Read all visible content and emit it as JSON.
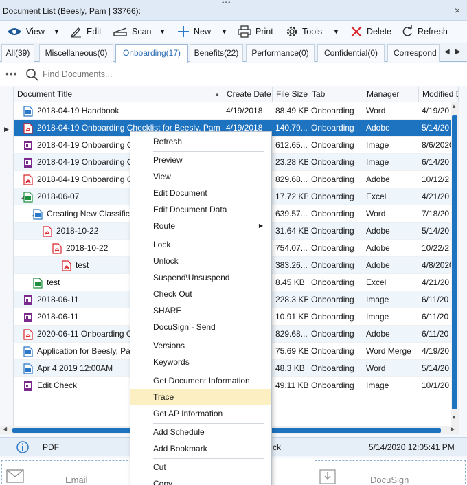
{
  "window": {
    "title": "Document List (Beesly, Pam | 33766):",
    "grip": "•••",
    "close_glyph": "×"
  },
  "toolbar": {
    "view": "View",
    "edit": "Edit",
    "scan": "Scan",
    "new": "New",
    "print": "Print",
    "tools": "Tools",
    "delete": "Delete",
    "refresh": "Refresh",
    "dropdown_glyph": "▼"
  },
  "tabs": {
    "items": [
      "All(39)",
      "Miscellaneous(0)",
      "Onboarding(17)",
      "Benefits(22)",
      "Performance(0)",
      "Confidential(0)",
      "Correspond"
    ],
    "active_index": 2,
    "prev_glyph": "◀",
    "next_glyph": "▶"
  },
  "search": {
    "more_glyph": "•••",
    "placeholder": "Find Documents..."
  },
  "grid": {
    "columns": [
      "Document Title",
      "Create Date",
      "File Size",
      "Tab",
      "Manager",
      "Modified D"
    ],
    "sort_glyph": "▲",
    "current_row_glyph": "▶",
    "expand_glyph": "◢",
    "rows": [
      {
        "title": "2018-04-19 Handbook",
        "date": "4/19/2018",
        "size": "88.49 KB",
        "tab": "Onboarding",
        "manager": "Word",
        "modified": "4/19/20"
      },
      {
        "title": "2018-04-19 Onboarding Checklist for Beesly, Pam",
        "date": "4/19/2018",
        "size": "140.79...",
        "tab": "Onboarding",
        "manager": "Adobe",
        "modified": "5/14/20"
      },
      {
        "title": "2018-04-19 Onboarding C",
        "date": "",
        "size": "612.65...",
        "tab": "Onboarding",
        "manager": "Image",
        "modified": "8/6/2020"
      },
      {
        "title": "2018-04-19 Onboarding C",
        "date": "",
        "size": "23.28 KB",
        "tab": "Onboarding",
        "manager": "Image",
        "modified": "6/14/20"
      },
      {
        "title": "2018-04-19 Onboarding C",
        "date": "",
        "size": "829.68...",
        "tab": "Onboarding",
        "manager": "Adobe",
        "modified": "10/12/2"
      },
      {
        "title": "2018-06-07",
        "date": "",
        "size": "17.72 KB",
        "tab": "Onboarding",
        "manager": "Excel",
        "modified": "4/21/20"
      },
      {
        "title": "Creating New Classifica",
        "date": "",
        "size": "639.57...",
        "tab": "Onboarding",
        "manager": "Word",
        "modified": "7/18/20"
      },
      {
        "title": "2018-10-22",
        "date": "",
        "size": "31.64 KB",
        "tab": "Onboarding",
        "manager": "Adobe",
        "modified": "5/14/20"
      },
      {
        "title": "2018-10-22",
        "date": "",
        "size": "754.07...",
        "tab": "Onboarding",
        "manager": "Adobe",
        "modified": "10/22/2"
      },
      {
        "title": "test",
        "date": "",
        "size": "383.26...",
        "tab": "Onboarding",
        "manager": "Adobe",
        "modified": "4/8/2020"
      },
      {
        "title": "test",
        "date": "",
        "size": "8.45 KB",
        "tab": "Onboarding",
        "manager": "Excel",
        "modified": "4/21/20"
      },
      {
        "title": "2018-06-11",
        "date": "",
        "size": "228.3 KB",
        "tab": "Onboarding",
        "manager": "Image",
        "modified": "6/11/20"
      },
      {
        "title": "2018-06-11",
        "date": "",
        "size": "10.91 KB",
        "tab": "Onboarding",
        "manager": "Image",
        "modified": "6/11/20"
      },
      {
        "title": "2020-06-11 Onboarding C",
        "date": "",
        "size": "829.68...",
        "tab": "Onboarding",
        "manager": "Adobe",
        "modified": "6/11/20"
      },
      {
        "title": "Application for Beesly, Pa",
        "date": "",
        "size": "75.69 KB",
        "tab": "Onboarding",
        "manager": "Word Merge",
        "modified": "4/19/20"
      },
      {
        "title": "Apr  4 2019 12:00AM",
        "date": "",
        "size": "48.3 KB",
        "tab": "Onboarding",
        "manager": "Word",
        "modified": "5/14/20"
      },
      {
        "title": "Edit Check",
        "date": "",
        "size": "49.11 KB",
        "tab": "Onboarding",
        "manager": "Image",
        "modified": "10/1/20"
      }
    ]
  },
  "scroll": {
    "up": "▲",
    "down": "▼",
    "left": "◀",
    "right": "▶"
  },
  "status": {
    "type": "PDF",
    "partial": "ck",
    "timestamp": "5/14/2020 12:05:41 PM"
  },
  "actions": {
    "email": "Email",
    "docusign": "DocuSign"
  },
  "menu": {
    "items": [
      "Refresh",
      "Preview",
      "View",
      "Edit Document",
      "Edit Document Data",
      "Route",
      "Lock",
      "Unlock",
      "Suspend\\Unsuspend",
      "Check Out",
      "SHARE",
      "DocuSign - Send",
      "Versions",
      "Keywords",
      "Get Document Information",
      "Trace",
      "Get AP Information",
      "Add Schedule",
      "Add Bookmark",
      "Cut",
      "Copy"
    ],
    "submenu_glyph": "▶",
    "highlighted": "Trace"
  },
  "colors": {
    "accent": "#1e73c0",
    "highlight": "#fcf0c2",
    "pdf": "#d9262b",
    "word": "#2b78c8",
    "excel": "#1f8e3d",
    "image": "#7a2a8c"
  }
}
